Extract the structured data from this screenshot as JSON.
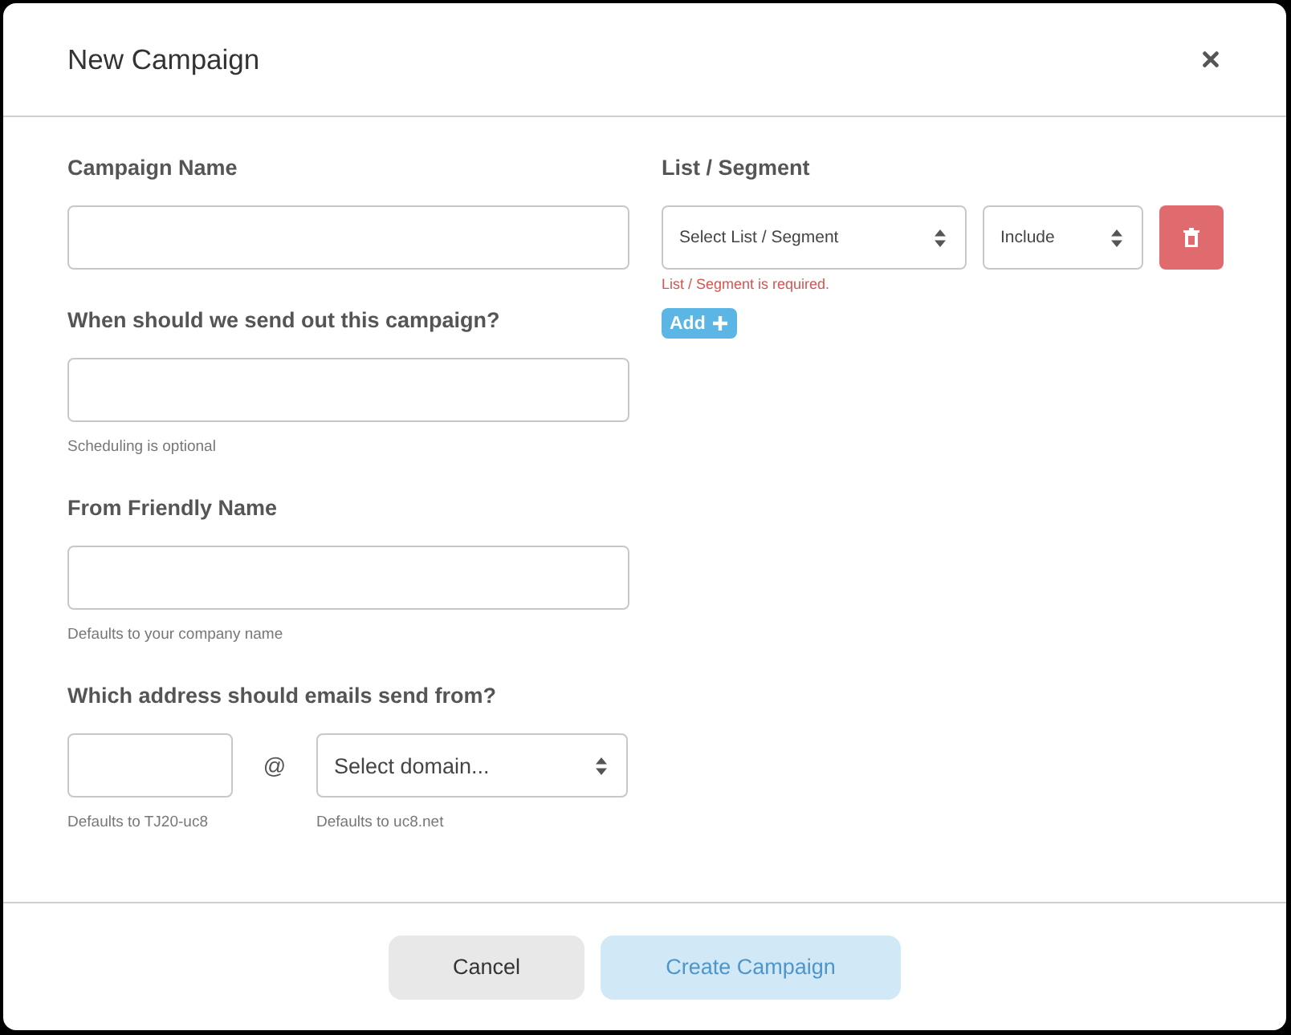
{
  "dialog": {
    "title": "New Campaign"
  },
  "left_fields": [
    {
      "kind": "text",
      "label": "Campaign Name"
    },
    {
      "kind": "text",
      "label": "When should we send out this campaign?",
      "hint": "Scheduling is optional"
    },
    {
      "kind": "text",
      "label": "From Friendly Name",
      "hint": "Defaults to your company name"
    },
    {
      "kind": "address",
      "label": "Which address should emails send from?",
      "separator": "@",
      "domain_select": "Select domain...",
      "local_hint": "Defaults to TJ20-uc8",
      "domain_hint": "Defaults to uc8.net"
    }
  ],
  "list_segment": {
    "label": "List / Segment",
    "rows": [
      {
        "list_select": "Select List / Segment",
        "mode_select": "Include"
      }
    ],
    "error": "List / Segment is required.",
    "add_button": "Add"
  },
  "footer": {
    "buttons": [
      {
        "label": "Cancel",
        "kind": "secondary",
        "disabled": false
      },
      {
        "label": "Create Campaign",
        "kind": "primary",
        "disabled": true
      }
    ]
  }
}
